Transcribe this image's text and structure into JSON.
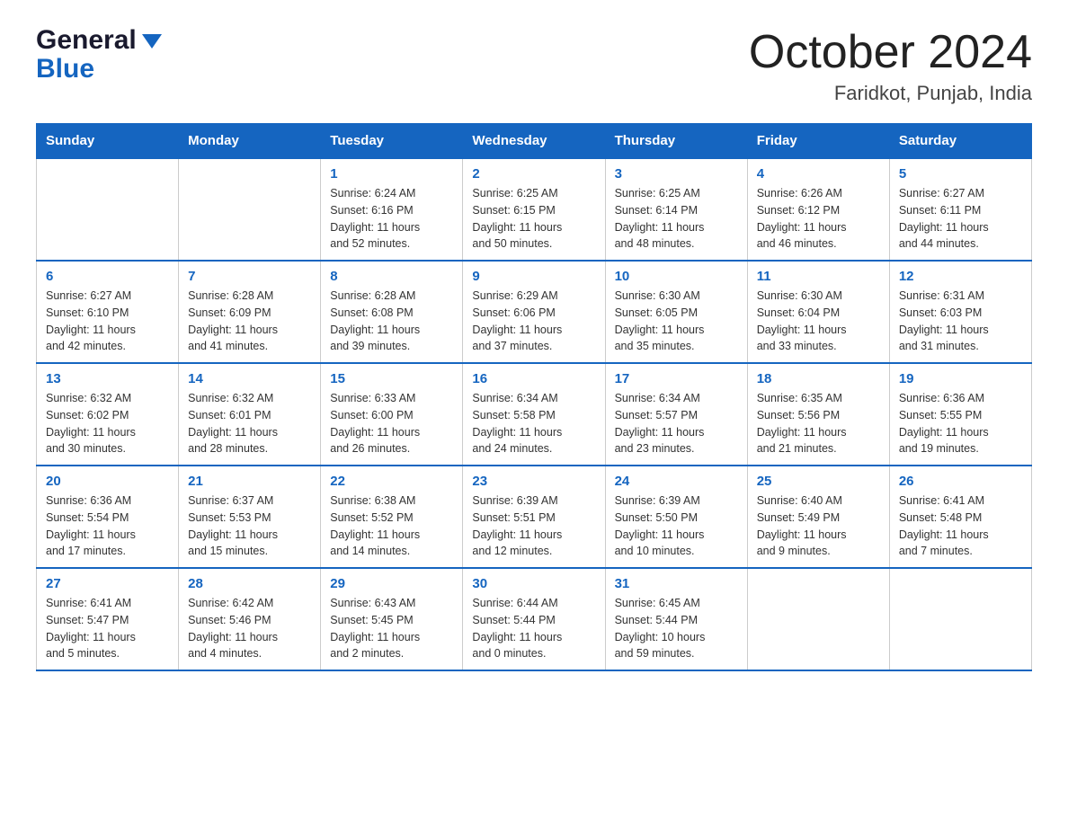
{
  "header": {
    "logo_line1": "General",
    "logo_line2": "Blue",
    "month_title": "October 2024",
    "location": "Faridkot, Punjab, India"
  },
  "days_of_week": [
    "Sunday",
    "Monday",
    "Tuesday",
    "Wednesday",
    "Thursday",
    "Friday",
    "Saturday"
  ],
  "weeks": [
    [
      {
        "day": "",
        "info": ""
      },
      {
        "day": "",
        "info": ""
      },
      {
        "day": "1",
        "info": "Sunrise: 6:24 AM\nSunset: 6:16 PM\nDaylight: 11 hours\nand 52 minutes."
      },
      {
        "day": "2",
        "info": "Sunrise: 6:25 AM\nSunset: 6:15 PM\nDaylight: 11 hours\nand 50 minutes."
      },
      {
        "day": "3",
        "info": "Sunrise: 6:25 AM\nSunset: 6:14 PM\nDaylight: 11 hours\nand 48 minutes."
      },
      {
        "day": "4",
        "info": "Sunrise: 6:26 AM\nSunset: 6:12 PM\nDaylight: 11 hours\nand 46 minutes."
      },
      {
        "day": "5",
        "info": "Sunrise: 6:27 AM\nSunset: 6:11 PM\nDaylight: 11 hours\nand 44 minutes."
      }
    ],
    [
      {
        "day": "6",
        "info": "Sunrise: 6:27 AM\nSunset: 6:10 PM\nDaylight: 11 hours\nand 42 minutes."
      },
      {
        "day": "7",
        "info": "Sunrise: 6:28 AM\nSunset: 6:09 PM\nDaylight: 11 hours\nand 41 minutes."
      },
      {
        "day": "8",
        "info": "Sunrise: 6:28 AM\nSunset: 6:08 PM\nDaylight: 11 hours\nand 39 minutes."
      },
      {
        "day": "9",
        "info": "Sunrise: 6:29 AM\nSunset: 6:06 PM\nDaylight: 11 hours\nand 37 minutes."
      },
      {
        "day": "10",
        "info": "Sunrise: 6:30 AM\nSunset: 6:05 PM\nDaylight: 11 hours\nand 35 minutes."
      },
      {
        "day": "11",
        "info": "Sunrise: 6:30 AM\nSunset: 6:04 PM\nDaylight: 11 hours\nand 33 minutes."
      },
      {
        "day": "12",
        "info": "Sunrise: 6:31 AM\nSunset: 6:03 PM\nDaylight: 11 hours\nand 31 minutes."
      }
    ],
    [
      {
        "day": "13",
        "info": "Sunrise: 6:32 AM\nSunset: 6:02 PM\nDaylight: 11 hours\nand 30 minutes."
      },
      {
        "day": "14",
        "info": "Sunrise: 6:32 AM\nSunset: 6:01 PM\nDaylight: 11 hours\nand 28 minutes."
      },
      {
        "day": "15",
        "info": "Sunrise: 6:33 AM\nSunset: 6:00 PM\nDaylight: 11 hours\nand 26 minutes."
      },
      {
        "day": "16",
        "info": "Sunrise: 6:34 AM\nSunset: 5:58 PM\nDaylight: 11 hours\nand 24 minutes."
      },
      {
        "day": "17",
        "info": "Sunrise: 6:34 AM\nSunset: 5:57 PM\nDaylight: 11 hours\nand 23 minutes."
      },
      {
        "day": "18",
        "info": "Sunrise: 6:35 AM\nSunset: 5:56 PM\nDaylight: 11 hours\nand 21 minutes."
      },
      {
        "day": "19",
        "info": "Sunrise: 6:36 AM\nSunset: 5:55 PM\nDaylight: 11 hours\nand 19 minutes."
      }
    ],
    [
      {
        "day": "20",
        "info": "Sunrise: 6:36 AM\nSunset: 5:54 PM\nDaylight: 11 hours\nand 17 minutes."
      },
      {
        "day": "21",
        "info": "Sunrise: 6:37 AM\nSunset: 5:53 PM\nDaylight: 11 hours\nand 15 minutes."
      },
      {
        "day": "22",
        "info": "Sunrise: 6:38 AM\nSunset: 5:52 PM\nDaylight: 11 hours\nand 14 minutes."
      },
      {
        "day": "23",
        "info": "Sunrise: 6:39 AM\nSunset: 5:51 PM\nDaylight: 11 hours\nand 12 minutes."
      },
      {
        "day": "24",
        "info": "Sunrise: 6:39 AM\nSunset: 5:50 PM\nDaylight: 11 hours\nand 10 minutes."
      },
      {
        "day": "25",
        "info": "Sunrise: 6:40 AM\nSunset: 5:49 PM\nDaylight: 11 hours\nand 9 minutes."
      },
      {
        "day": "26",
        "info": "Sunrise: 6:41 AM\nSunset: 5:48 PM\nDaylight: 11 hours\nand 7 minutes."
      }
    ],
    [
      {
        "day": "27",
        "info": "Sunrise: 6:41 AM\nSunset: 5:47 PM\nDaylight: 11 hours\nand 5 minutes."
      },
      {
        "day": "28",
        "info": "Sunrise: 6:42 AM\nSunset: 5:46 PM\nDaylight: 11 hours\nand 4 minutes."
      },
      {
        "day": "29",
        "info": "Sunrise: 6:43 AM\nSunset: 5:45 PM\nDaylight: 11 hours\nand 2 minutes."
      },
      {
        "day": "30",
        "info": "Sunrise: 6:44 AM\nSunset: 5:44 PM\nDaylight: 11 hours\nand 0 minutes."
      },
      {
        "day": "31",
        "info": "Sunrise: 6:45 AM\nSunset: 5:44 PM\nDaylight: 10 hours\nand 59 minutes."
      },
      {
        "day": "",
        "info": ""
      },
      {
        "day": "",
        "info": ""
      }
    ]
  ]
}
